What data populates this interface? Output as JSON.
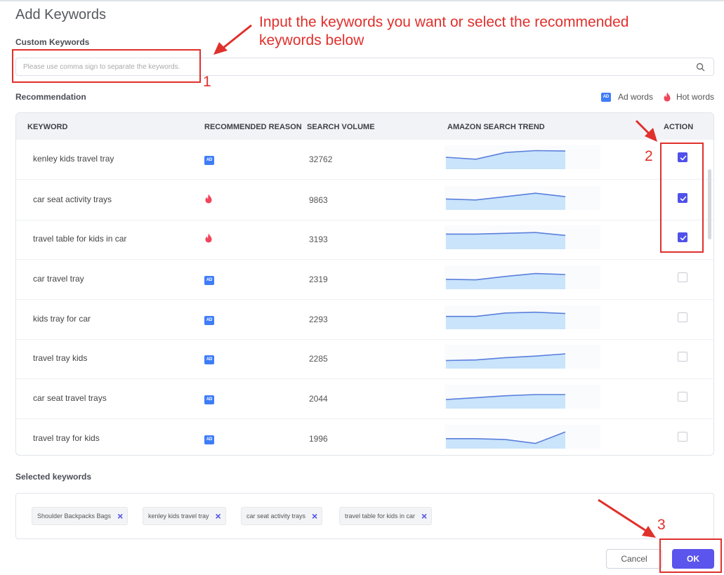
{
  "dialog": {
    "title": "Add Keywords",
    "custom_label": "Custom Keywords",
    "search_placeholder": "Please use comma sign to separate the keywords.",
    "search_value": "",
    "recommendation_label": "Recommendation",
    "selected_label": "Selected keywords"
  },
  "legend": {
    "ad_badge": "AD",
    "ad_label": "Ad words",
    "hot_label": "Hot words"
  },
  "table": {
    "headers": {
      "keyword": "KEYWORD",
      "reason": "RECOMMENDED REASON",
      "volume": "SEARCH VOLUME",
      "trend": "AMAZON SEARCH TREND",
      "action": "ACTION"
    },
    "rows": [
      {
        "keyword": "kenley kids travel tray",
        "reason": "ad",
        "volume": "32762",
        "checked": true,
        "trend": [
          0.55,
          0.45,
          0.8,
          0.9,
          0.88
        ]
      },
      {
        "keyword": "car seat activity trays",
        "reason": "hot",
        "volume": "9863",
        "checked": true,
        "trend": [
          0.5,
          0.45,
          0.62,
          0.8,
          0.62
        ]
      },
      {
        "keyword": "travel table for kids in car",
        "reason": "hot",
        "volume": "3193",
        "checked": true,
        "trend": [
          0.72,
          0.72,
          0.76,
          0.8,
          0.65
        ]
      },
      {
        "keyword": "car travel tray",
        "reason": "ad",
        "volume": "2319",
        "checked": false,
        "trend": [
          0.45,
          0.42,
          0.6,
          0.75,
          0.7
        ]
      },
      {
        "keyword": "kids tray for car",
        "reason": "ad",
        "volume": "2293",
        "checked": false,
        "trend": [
          0.6,
          0.6,
          0.78,
          0.82,
          0.75
        ]
      },
      {
        "keyword": "travel tray kids",
        "reason": "ad",
        "volume": "2285",
        "checked": false,
        "trend": [
          0.35,
          0.38,
          0.5,
          0.58,
          0.7
        ]
      },
      {
        "keyword": "car seat travel trays",
        "reason": "ad",
        "volume": "2044",
        "checked": false,
        "trend": [
          0.4,
          0.5,
          0.6,
          0.66,
          0.66
        ]
      },
      {
        "keyword": "travel tray for kids",
        "reason": "ad",
        "volume": "1996",
        "checked": false,
        "trend": [
          0.45,
          0.45,
          0.4,
          0.2,
          0.8
        ]
      }
    ]
  },
  "selected": [
    "Shoulder Backpacks Bags",
    "kenley kids travel tray",
    "car seat activity trays",
    "travel table for kids in car"
  ],
  "buttons": {
    "cancel": "Cancel",
    "ok": "OK"
  },
  "annotations": {
    "callout": "Input the keywords you want or select the recommended keywords below",
    "step1": "1",
    "step2": "2",
    "step3": "3",
    "color": "#e0302c"
  },
  "colors": {
    "accent": "#5b54ed",
    "ad_badge": "#3f7df7",
    "hot": "#f0455b",
    "trend_line": "#5b7fdc",
    "trend_fill": "#c9e4fb"
  }
}
